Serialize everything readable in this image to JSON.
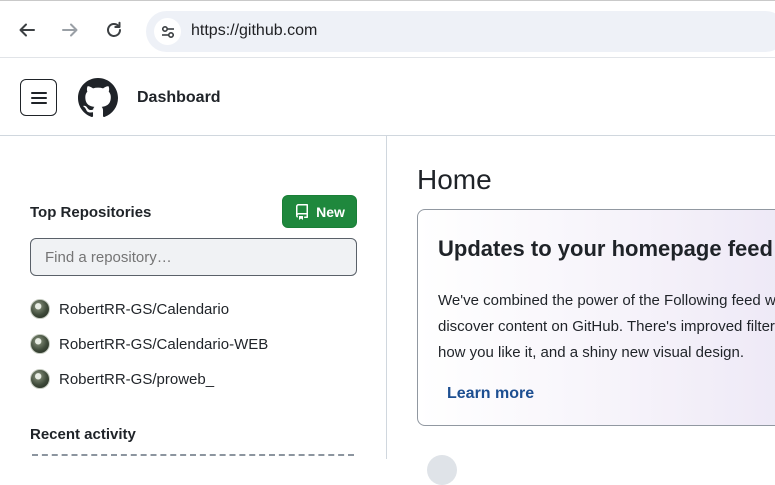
{
  "browser": {
    "url": "https://github.com",
    "back_icon": "arrow-left-icon",
    "forward_icon": "arrow-right-icon",
    "reload_icon": "reload-icon",
    "site_info_icon": "tune-icon"
  },
  "header": {
    "title": "Dashboard",
    "menu_icon": "hamburger-icon",
    "logo_icon": "github-octocat-icon"
  },
  "sidebar": {
    "top_repositories_title": "Top Repositories",
    "new_button_label": "New",
    "filter_placeholder": "Find a repository…",
    "repositories": [
      {
        "name": "RobertRR-GS/Calendario"
      },
      {
        "name": "RobertRR-GS/Calendario-WEB"
      },
      {
        "name": "RobertRR-GS/proweb_"
      }
    ],
    "recent_activity_title": "Recent activity"
  },
  "main": {
    "title": "Home",
    "card": {
      "title": "Updates to your homepage feed",
      "body_lines": [
        "We've combined the power of the Following feed with the For you feed so there's one place to",
        "discover content on GitHub. There's improved filtering so you can customize your feed exactly",
        "how you like it, and a shiny new visual design."
      ],
      "link_label": "Learn more"
    }
  },
  "colors": {
    "accent_green": "#1f883d",
    "link_blue": "#1d4f91",
    "url_bar_bg": "#eef1f7"
  }
}
